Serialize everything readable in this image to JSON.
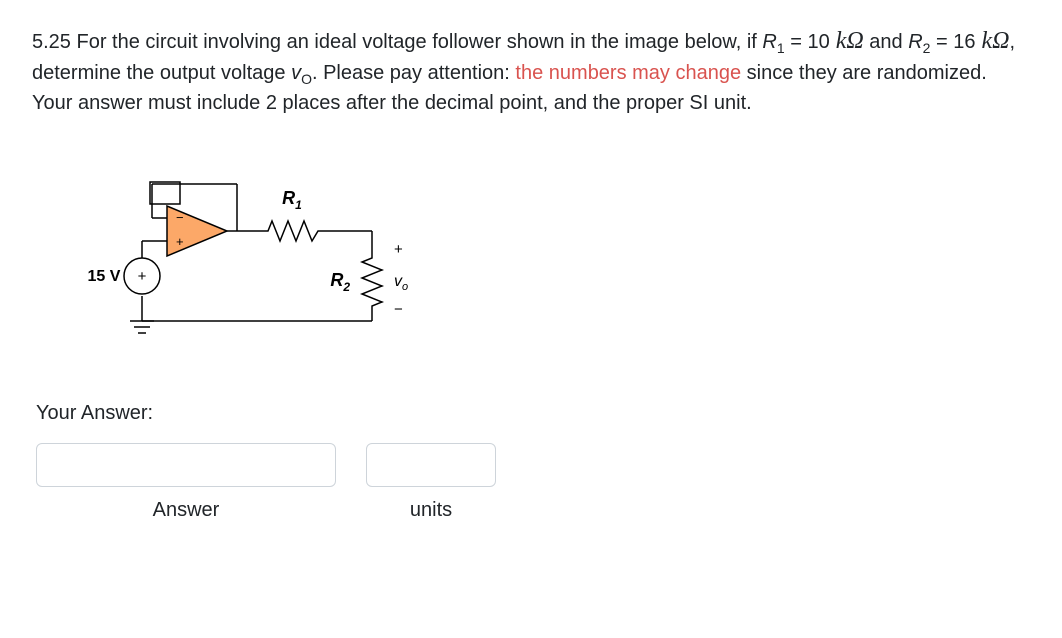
{
  "question": {
    "number": "5.25",
    "lead": " For the circuit involving an ideal voltage follower shown in the image below, if ",
    "r1_label": "R",
    "r1_sub": "1",
    "eq": " = ",
    "r1_val": "10",
    "kohm": " kΩ",
    "and": " and  ",
    "r2_label": "R",
    "r2_sub": "2",
    "r2_val": "16",
    "tail1": ", determine the output voltage ",
    "vo_v": "v",
    "vo_o": "O",
    "tail2": ". Please pay attention: ",
    "red": "the numbers may change",
    "tail3": " since they are randomized. Your answer must include 2 places after the decimal point, and the proper SI unit."
  },
  "circuit": {
    "source": "15 V",
    "r1": "R",
    "r1_sub": "1",
    "r2": "R",
    "r2_sub": "2",
    "vo": "v",
    "vo_sub": "o",
    "plus": "+",
    "minus": "−",
    "opamp_plus": "+",
    "opamp_minus": "−",
    "src_plus": "+"
  },
  "answer_section": {
    "your_answer": "Your Answer:",
    "answer_label": "Answer",
    "units_label": "units"
  }
}
